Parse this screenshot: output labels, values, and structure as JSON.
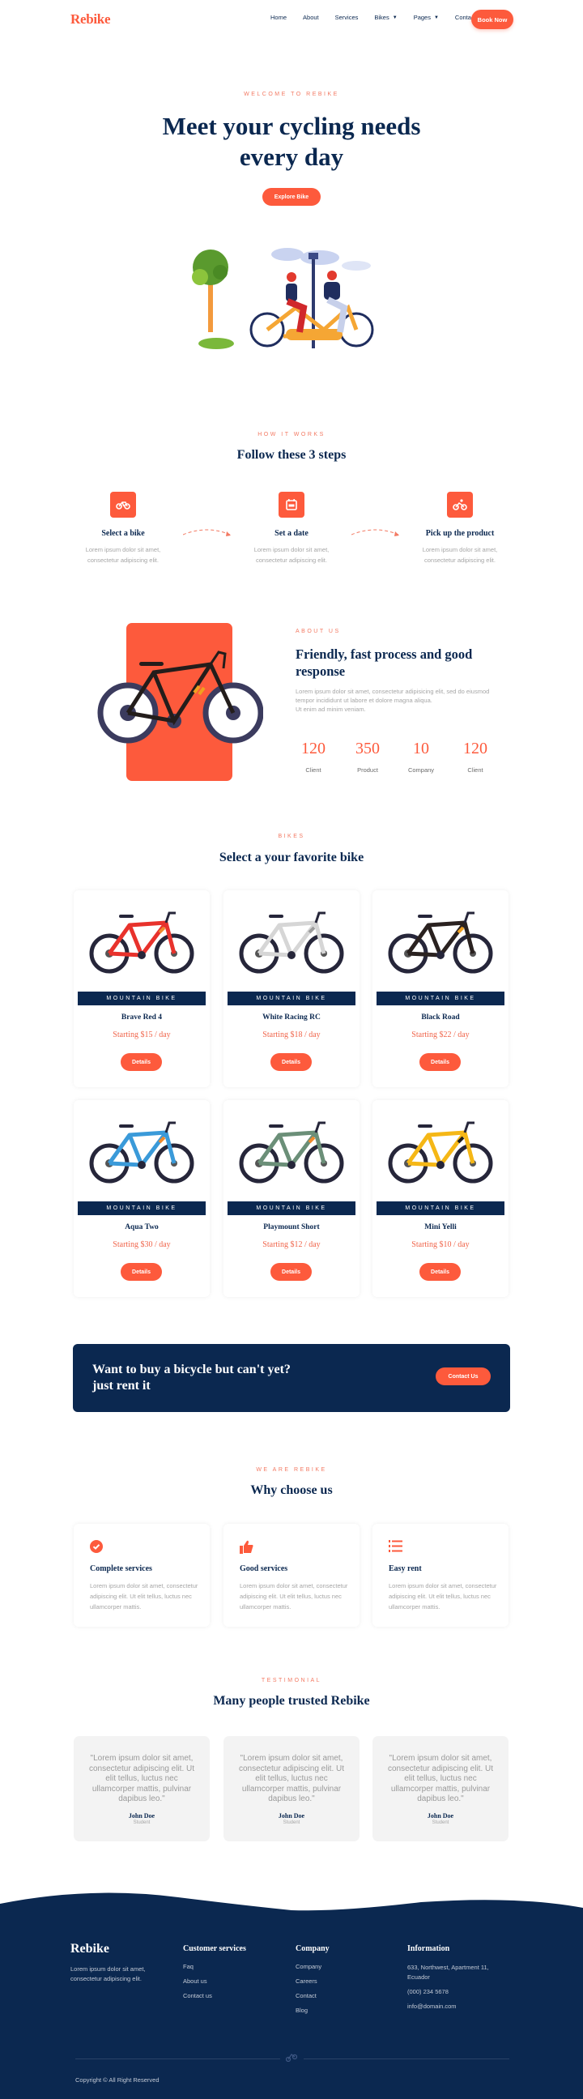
{
  "header": {
    "logo": "Rebike",
    "nav": [
      {
        "label": "Home",
        "has_dropdown": false
      },
      {
        "label": "About",
        "has_dropdown": false
      },
      {
        "label": "Services",
        "has_dropdown": false
      },
      {
        "label": "Bikes",
        "has_dropdown": true
      },
      {
        "label": "Pages",
        "has_dropdown": true
      },
      {
        "label": "Contact",
        "has_dropdown": false
      }
    ],
    "cta_label": "Book Now"
  },
  "hero": {
    "eyebrow": "WELCOME TO REBIKE",
    "title": "Meet your cycling needs every day",
    "button_label": "Explore Bike",
    "illustration": "tandem-bicycle-couple-illustration"
  },
  "how_it_works": {
    "eyebrow": "HOW IT WORKS",
    "title": "Follow these 3 steps",
    "steps": [
      {
        "icon": "bicycle-icon",
        "title": "Select a bike",
        "text": "Lorem ipsum dolor sit amet, consectetur adipiscing elit."
      },
      {
        "icon": "calendar-icon",
        "title": "Set a date",
        "text": "Lorem ipsum dolor sit amet, consectetur adipiscing elit."
      },
      {
        "icon": "cyclist-icon",
        "title": "Pick up the product",
        "text": "Lorem ipsum dolor sit amet, consectetur adipiscing elit."
      }
    ]
  },
  "about": {
    "eyebrow": "ABOUT US",
    "title": "Friendly, fast process and good response",
    "text1": "Lorem ipsum dolor sit amet, consectetur adipisicing elit, sed do eiusmod tempor incididunt ut labore et dolore magna aliqua.",
    "text2": "Ut enim ad minim veniam.",
    "stats": [
      {
        "value": "120",
        "label": "Client"
      },
      {
        "value": "350",
        "label": "Product"
      },
      {
        "value": "10",
        "label": "Company"
      },
      {
        "value": "120",
        "label": "Client"
      }
    ]
  },
  "bikes": {
    "eyebrow": "BIKES",
    "title": "Select a your favorite bike",
    "details_label": "Details",
    "items": [
      {
        "category": "MOUNTAIN BIKE",
        "name": "Brave Red 4",
        "price": "Starting $15 / day",
        "frame_color": "#e8322c",
        "accent": "#f08a2c"
      },
      {
        "category": "MOUNTAIN BIKE",
        "name": "White Racing RC",
        "price": "Starting $18 / day",
        "frame_color": "#d6d6d6",
        "accent": "#9c9c9c"
      },
      {
        "category": "MOUNTAIN BIKE",
        "name": "Black Road",
        "price": "Starting $22 / day",
        "frame_color": "#2a2220",
        "accent": "#f0a020"
      },
      {
        "category": "MOUNTAIN BIKE",
        "name": "Aqua Two",
        "price": "Starting $30 / day",
        "frame_color": "#3a9ad9",
        "accent": "#f08a2c"
      },
      {
        "category": "MOUNTAIN BIKE",
        "name": "Playmount Short",
        "price": "Starting $12 / day",
        "frame_color": "#6b8f78",
        "accent": "#f08a2c"
      },
      {
        "category": "MOUNTAIN BIKE",
        "name": "Mini Yelli",
        "price": "Starting $10 / day",
        "frame_color": "#f5b716",
        "accent": "#1a1a1a"
      }
    ]
  },
  "cta": {
    "text": "Want to buy a bicycle but can't yet? just rent it",
    "button_label": "Contact Us"
  },
  "why": {
    "eyebrow": "WE ARE REBIKE",
    "title": "Why choose us",
    "items": [
      {
        "icon": "check-circle-icon",
        "title": "Complete services",
        "text": "Lorem ipsum dolor sit amet, consectetur adipiscing elit. Ut elit tellus, luctus nec ullamcorper mattis."
      },
      {
        "icon": "thumbs-up-icon",
        "title": "Good services",
        "text": "Lorem ipsum dolor sit amet, consectetur adipiscing elit. Ut elit tellus, luctus nec ullamcorper mattis."
      },
      {
        "icon": "numbered-list-icon",
        "title": "Easy rent",
        "text": "Lorem ipsum dolor sit amet, consectetur adipiscing elit. Ut elit tellus, luctus nec ullamcorper mattis."
      }
    ]
  },
  "testimonials": {
    "eyebrow": "TESTIMONIAL",
    "title": "Many people trusted Rebike",
    "items": [
      {
        "quote": "\"Lorem ipsum dolor sit amet, consectetur adipiscing elit. Ut elit tellus, luctus nec ullamcorper mattis, pulvinar dapibus leo.\"",
        "name": "John Doe",
        "role": "Student"
      },
      {
        "quote": "\"Lorem ipsum dolor sit amet, consectetur adipiscing elit. Ut elit tellus, luctus nec ullamcorper mattis, pulvinar dapibus leo.\"",
        "name": "John Doe",
        "role": "Student"
      },
      {
        "quote": "\"Lorem ipsum dolor sit amet, consectetur adipiscing elit. Ut elit tellus, luctus nec ullamcorper mattis, pulvinar dapibus leo.\"",
        "name": "John Doe",
        "role": "Student"
      }
    ]
  },
  "footer": {
    "logo": "Rebike",
    "about": "Lorem ipsum dolor sit amet, consectetur adipiscing elit.",
    "columns": [
      {
        "title": "Customer services",
        "links": [
          "Faq",
          "About us",
          "Contact us"
        ]
      },
      {
        "title": "Company",
        "links": [
          "Company",
          "Careers",
          "Contact",
          "Blog"
        ]
      }
    ],
    "info": {
      "title": "Information",
      "address": "633, Northwest, Apartment 11, Ecuador",
      "phone": "(000) 234 5678",
      "email": "info@domain.com"
    },
    "copyright": "Copyright © All Right Reserved"
  },
  "colors": {
    "accent": "#fd5a3c",
    "navy": "#0b2850",
    "muted": "#a6a6a6"
  }
}
